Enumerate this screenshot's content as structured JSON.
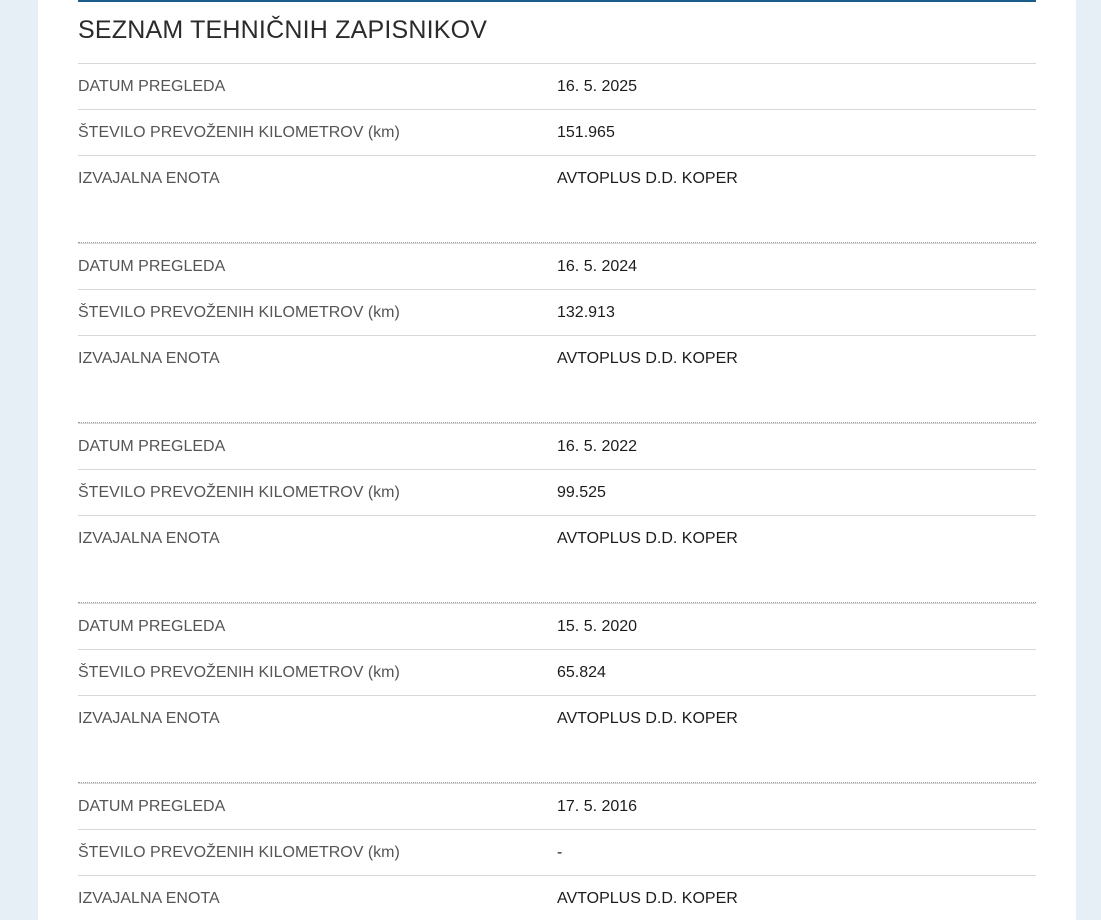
{
  "page": {
    "title": "SEZNAM TEHNIČNIH ZAPISNIKOV"
  },
  "labels": {
    "date": "DATUM PREGLEDA",
    "km": "ŠTEVILO PREVOŽENIH KILOMETROV (km)",
    "unit": "IZVAJALNA ENOTA"
  },
  "records": [
    {
      "date": "16. 5. 2025",
      "km": "151.965",
      "unit": "AVTOPLUS D.D. KOPER"
    },
    {
      "date": "16. 5. 2024",
      "km": "132.913",
      "unit": "AVTOPLUS D.D. KOPER"
    },
    {
      "date": "16. 5. 2022",
      "km": "99.525",
      "unit": "AVTOPLUS D.D. KOPER"
    },
    {
      "date": "15. 5. 2020",
      "km": "65.824",
      "unit": "AVTOPLUS D.D. KOPER"
    },
    {
      "date": "17. 5. 2016",
      "km": "-",
      "unit": "AVTOPLUS D.D. KOPER"
    }
  ]
}
